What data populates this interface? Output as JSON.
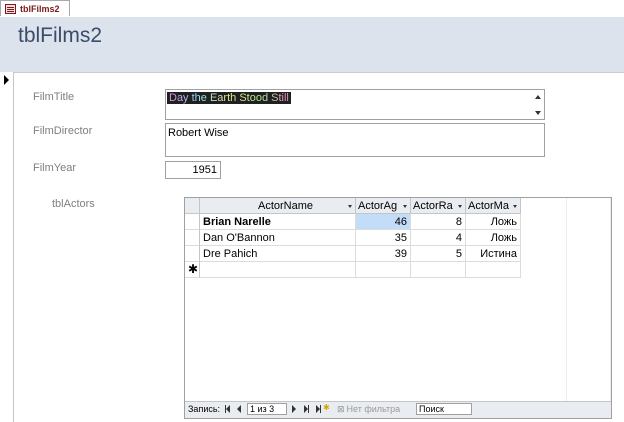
{
  "tab": {
    "label": "tblFilms2"
  },
  "header": {
    "title": "tblFilms2"
  },
  "fields": {
    "film_title_label": "FilmTitle",
    "film_title_value": "Day the Earth Stood Still",
    "film_director_label": "FilmDirector",
    "film_director_value": "Robert Wise",
    "film_year_label": "FilmYear",
    "film_year_value": "1951"
  },
  "subform": {
    "label": "tblActors",
    "columns": [
      "ActorName",
      "ActorAg",
      "ActorRa",
      "ActorMa"
    ],
    "rows": [
      {
        "name": "Brian Narelle",
        "age": "46",
        "rating": "8",
        "married": "Ложь"
      },
      {
        "name": "Dan O'Bannon",
        "age": "35",
        "rating": "4",
        "married": "Ложь"
      },
      {
        "name": "Dre Pahich",
        "age": "39",
        "rating": "5",
        "married": "Истина"
      }
    ],
    "new_row_marker": "✱"
  },
  "navigation": {
    "record_label": "Запись:",
    "position": "1 из 3",
    "filter_label": "Нет фильтра",
    "search_placeholder": "Поиск"
  }
}
